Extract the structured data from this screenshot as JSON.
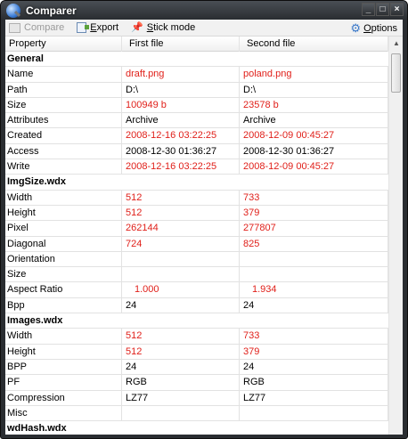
{
  "window": {
    "title": "Comparer",
    "minimize": "_",
    "maximize": "□",
    "close": "×"
  },
  "toolbar": {
    "compare": "Compare",
    "export": "Export",
    "stick_mode": "Stick mode",
    "options": "Options"
  },
  "table": {
    "headers": [
      "Property",
      "First file",
      "Second file"
    ],
    "rows": [
      {
        "type": "group",
        "label": "General"
      },
      {
        "label": "Name",
        "a": "draft.png",
        "b": "poland.png",
        "diff": true
      },
      {
        "label": "Path",
        "a": "D:\\",
        "b": "D:\\",
        "diff": false
      },
      {
        "label": "Size",
        "a": "100949 b",
        "b": "23578 b",
        "diff": true
      },
      {
        "label": "Attributes",
        "a": "Archive",
        "b": "Archive",
        "diff": false
      },
      {
        "label": "Created",
        "a": "2008-12-16 03:22:25",
        "b": "2008-12-09 00:45:27",
        "diff": true
      },
      {
        "label": "Access",
        "a": "2008-12-30 01:36:27",
        "b": "2008-12-30 01:36:27",
        "diff": false
      },
      {
        "label": "Write",
        "a": "2008-12-16 03:22:25",
        "b": "2008-12-09 00:45:27",
        "diff": true
      },
      {
        "type": "group",
        "label": "ImgSize.wdx"
      },
      {
        "label": "Width",
        "a": "512",
        "b": "733",
        "diff": true
      },
      {
        "label": "Height",
        "a": "512",
        "b": "379",
        "diff": true
      },
      {
        "label": "Pixel",
        "a": "262144",
        "b": "277807",
        "diff": true
      },
      {
        "label": "Diagonal",
        "a": "724",
        "b": "825",
        "diff": true
      },
      {
        "label": "Orientation",
        "a": "",
        "b": "",
        "diff": false
      },
      {
        "label": "Size",
        "a": "",
        "b": "",
        "diff": false
      },
      {
        "label": "Aspect Ratio",
        "a": "1.000",
        "b": "1.934",
        "diff": true,
        "indent": true
      },
      {
        "label": "Bpp",
        "a": "24",
        "b": "24",
        "diff": false
      },
      {
        "type": "group",
        "label": "Images.wdx"
      },
      {
        "label": "Width",
        "a": "512",
        "b": "733",
        "diff": true
      },
      {
        "label": "Height",
        "a": "512",
        "b": "379",
        "diff": true
      },
      {
        "label": "BPP",
        "a": "24",
        "b": "24",
        "diff": false
      },
      {
        "label": "PF",
        "a": "RGB",
        "b": "RGB",
        "diff": false
      },
      {
        "label": "Compression",
        "a": "LZ77",
        "b": "LZ77",
        "diff": false
      },
      {
        "label": "Misc",
        "a": "",
        "b": "",
        "diff": false
      },
      {
        "type": "group",
        "label": "wdHash.wdx"
      }
    ]
  },
  "colors": {
    "diff": "#e0201a",
    "titlebar": "#2a2d31"
  },
  "scroll": {
    "position": 0
  }
}
